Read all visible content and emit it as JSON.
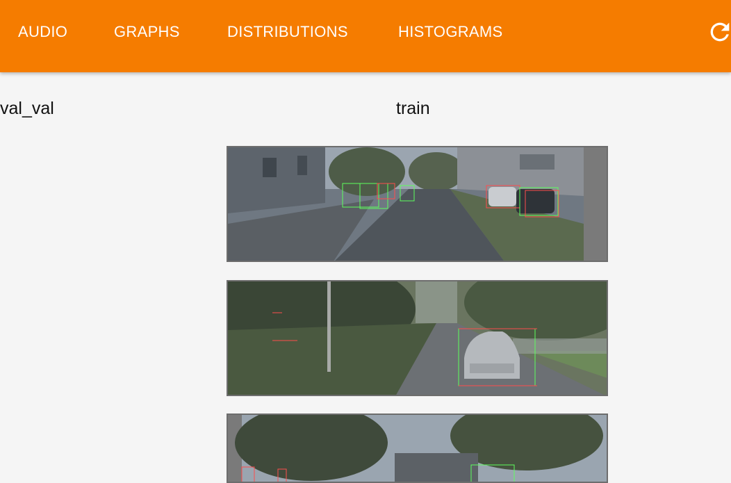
{
  "tabs": [
    {
      "label": "AUDIO"
    },
    {
      "label": "GRAPHS"
    },
    {
      "label": "DISTRIBUTIONS"
    },
    {
      "label": "HISTOGRAMS"
    }
  ],
  "toolbar": {
    "reload_icon": "reload-icon"
  },
  "runs": {
    "left": "val_val",
    "right": "train"
  },
  "colors": {
    "accent": "#f57c00",
    "background": "#f5f5f5",
    "box_green": "#5dff5d",
    "box_red": "#ff4d4d"
  }
}
